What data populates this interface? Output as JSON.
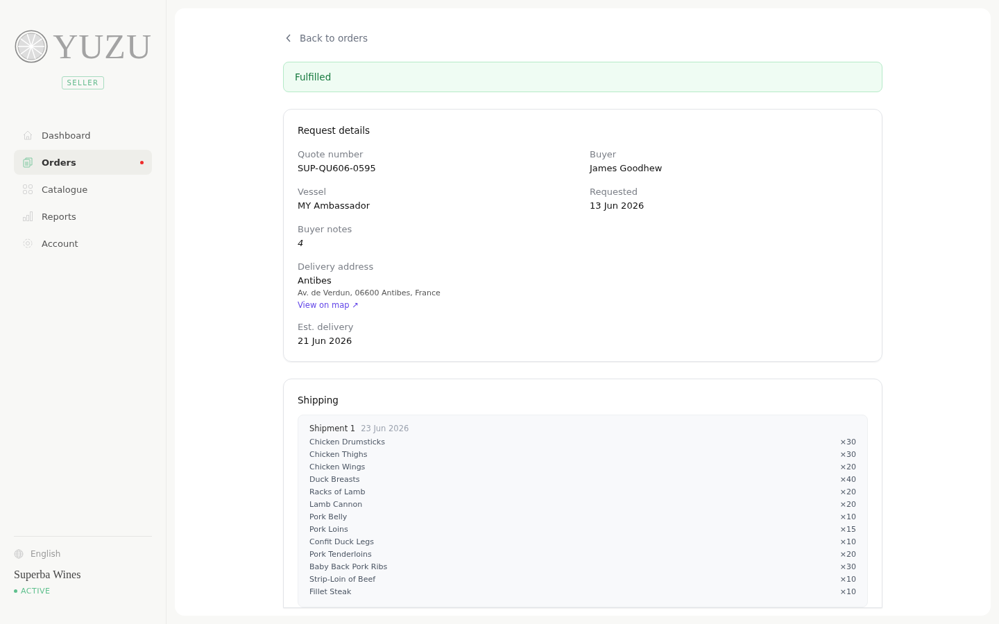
{
  "brand": {
    "name": "YUZU",
    "badge": "SELLER"
  },
  "nav": [
    {
      "label": "Dashboard",
      "selected": false,
      "notify": false
    },
    {
      "label": "Orders",
      "selected": true,
      "notify": true
    },
    {
      "label": "Catalogue",
      "selected": false,
      "notify": false
    },
    {
      "label": "Reports",
      "selected": false,
      "notify": false
    },
    {
      "label": "Account",
      "selected": false,
      "notify": false
    }
  ],
  "language": "English",
  "account": {
    "name": "Superba Wines",
    "status": "ACTIVE"
  },
  "back_link": "Back to orders",
  "status_banner": "Fulfilled",
  "request": {
    "title": "Request details",
    "fields": [
      {
        "label": "Quote number",
        "value": "SUP-QU606-0595"
      },
      {
        "label": "Buyer",
        "value": "James Goodhew"
      },
      {
        "label": "Vessel",
        "value": "MY Ambassador"
      },
      {
        "label": "Requested",
        "value": "13 Jun 2026"
      }
    ],
    "notes": {
      "label": "Buyer notes",
      "value": "4"
    },
    "address": {
      "label": "Delivery address",
      "name": "Antibes",
      "line": "Av. de Verdun, 06600 Antibes, France",
      "link": "View on map ↗"
    },
    "delivery": {
      "label": "Est. delivery",
      "value": "21 Jun 2026"
    }
  },
  "shipping": {
    "title": "Shipping",
    "shipments": [
      {
        "name": "Shipment 1",
        "date": "23 Jun 2026",
        "items": [
          {
            "name": "Chicken Drumsticks",
            "qty": "×30"
          },
          {
            "name": "Chicken Thighs",
            "qty": "×30"
          },
          {
            "name": "Chicken Wings",
            "qty": "×20"
          },
          {
            "name": "Duck Breasts",
            "qty": "×40"
          },
          {
            "name": "Racks of Lamb",
            "qty": "×20"
          },
          {
            "name": "Lamb Cannon",
            "qty": "×20"
          },
          {
            "name": "Pork Belly",
            "qty": "×10"
          },
          {
            "name": "Pork Loins",
            "qty": "×15"
          },
          {
            "name": "Confit Duck Legs",
            "qty": "×10"
          },
          {
            "name": "Pork Tenderloins",
            "qty": "×20"
          },
          {
            "name": "Baby Back Pork Ribs",
            "qty": "×30"
          },
          {
            "name": "Strip-Loin of Beef",
            "qty": "×10"
          },
          {
            "name": "Fillet Steak",
            "qty": "×10"
          }
        ]
      }
    ]
  }
}
